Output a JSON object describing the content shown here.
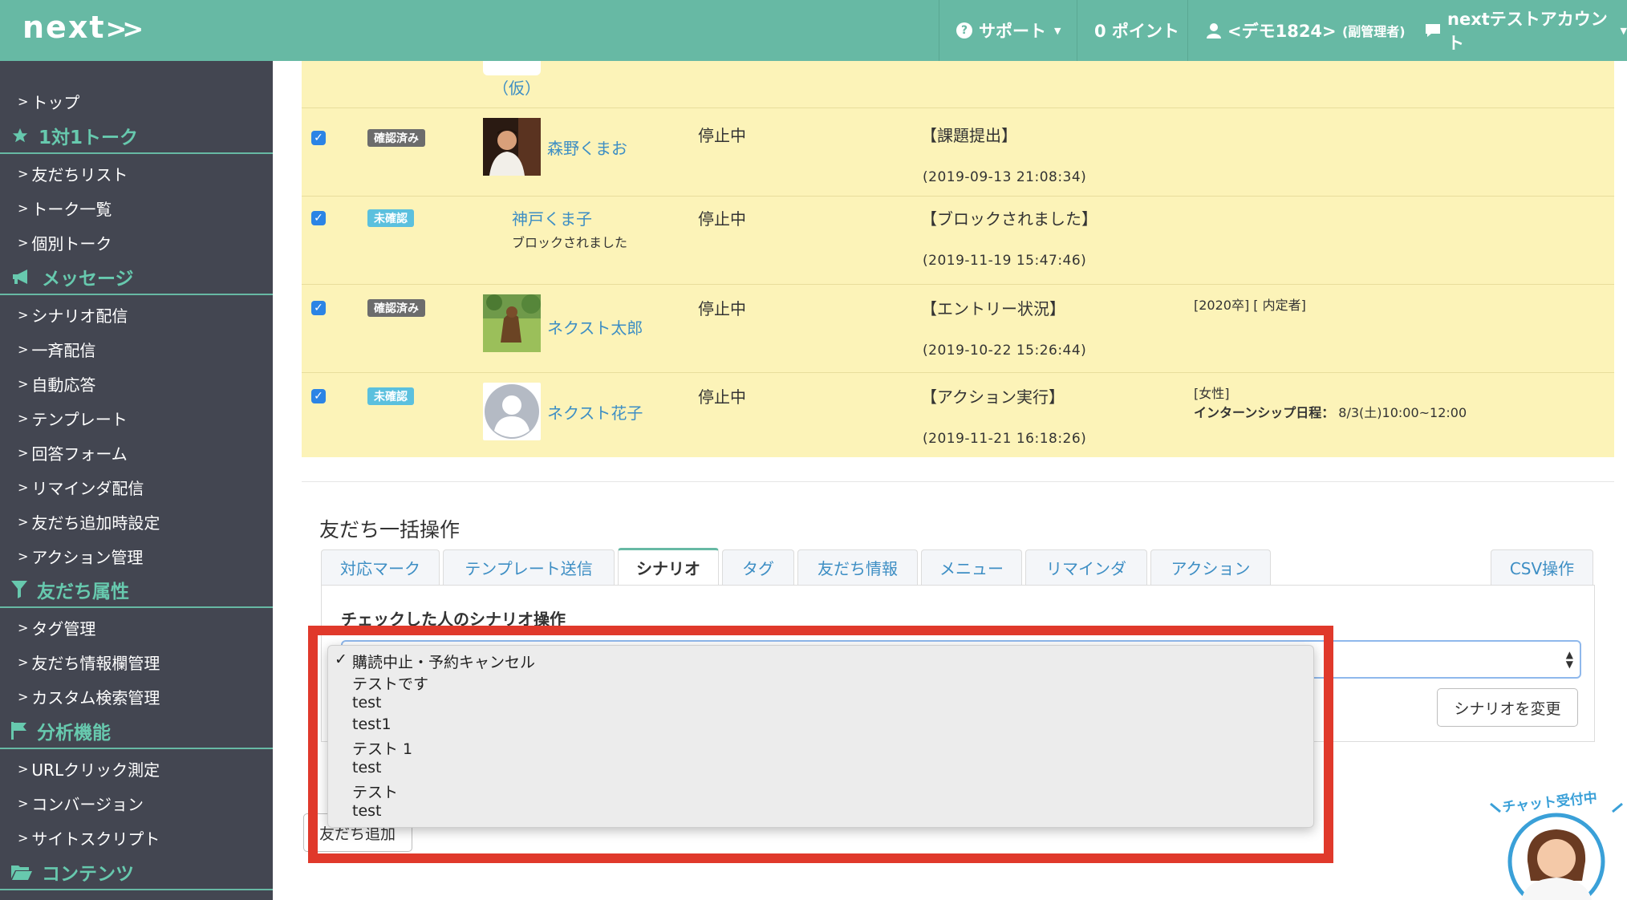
{
  "header": {
    "logo": "next",
    "support": "サポート",
    "points": "0 ポイント",
    "user": "<デモ1824>",
    "user_role": "(副管理者)",
    "account": "nextテストアカウント"
  },
  "sidebar": {
    "top": "トップ",
    "sections": [
      {
        "title": "1対1トーク",
        "items": [
          "友だちリスト",
          "トーク一覧",
          "個別トーク"
        ]
      },
      {
        "title": "メッセージ",
        "items": [
          "シナリオ配信",
          "一斉配信",
          "自動応答",
          "テンプレート",
          "回答フォーム",
          "リマインダ配信",
          "友だち追加時設定",
          "アクション管理"
        ]
      },
      {
        "title": "友だち属性",
        "items": [
          "タグ管理",
          "友だち情報欄管理",
          "カスタム検索管理"
        ]
      },
      {
        "title": "分析機能",
        "items": [
          "URLクリック測定",
          "コンバージョン",
          "サイトスクリプト"
        ]
      },
      {
        "title": "コンテンツ",
        "items": []
      }
    ]
  },
  "table": {
    "partial_name": "（仮）",
    "rows": [
      {
        "badge": "確認済み",
        "name": "森野くまお",
        "sub": "",
        "status": "停止中",
        "event": "【課題提出】",
        "datetime": "(2019-09-13 21:08:34)",
        "tag1": "",
        "tag2_label": "",
        "tag2_value": ""
      },
      {
        "badge": "未確認",
        "name": "神戸くま子",
        "sub": "ブロックされました",
        "status": "停止中",
        "event": "【ブロックされました】",
        "datetime": "(2019-11-19 15:47:46)",
        "tag1": "",
        "tag2_label": "",
        "tag2_value": ""
      },
      {
        "badge": "確認済み",
        "name": "ネクスト太郎",
        "sub": "",
        "status": "停止中",
        "event": "【エントリー状況】",
        "datetime": "(2019-10-22 15:26:44)",
        "tag1": "[2020卒] [ 内定者]",
        "tag2_label": "",
        "tag2_value": ""
      },
      {
        "badge": "未確認",
        "name": "ネクスト花子",
        "sub": "",
        "status": "停止中",
        "event": "【アクション実行】",
        "datetime": "(2019-11-21 16:18:26)",
        "tag1": "[女性]",
        "tag2_label": "インターンシップ日程：",
        "tag2_value": " 8/3(土)10:00~12:00"
      }
    ]
  },
  "bulk": {
    "title": "友だち一括操作",
    "tabs": [
      "対応マーク",
      "テンプレート送信",
      "シナリオ",
      "タグ",
      "友だち情報",
      "メニュー",
      "リマインダ",
      "アクション"
    ],
    "csv_tab": "CSV操作",
    "panel_label": "チェックした人のシナリオ操作",
    "change_button": "シナリオを変更",
    "add_friend_button": "友だち追加"
  },
  "dropdown": {
    "selected": "購読中止・予約キャンセル",
    "options": [
      "購読中止・予約キャンセル",
      "テストです",
      "test",
      "test1",
      "テスト 1",
      "test",
      "テスト",
      "test"
    ]
  },
  "chat": {
    "label": "チャット受付中"
  },
  "colors": {
    "header": "#67b9a4",
    "sidebar": "#434651",
    "accent": "#67c9ae",
    "highlight_row": "#fcf3b8",
    "link": "#3d8ec4",
    "frame": "#e0392b"
  }
}
